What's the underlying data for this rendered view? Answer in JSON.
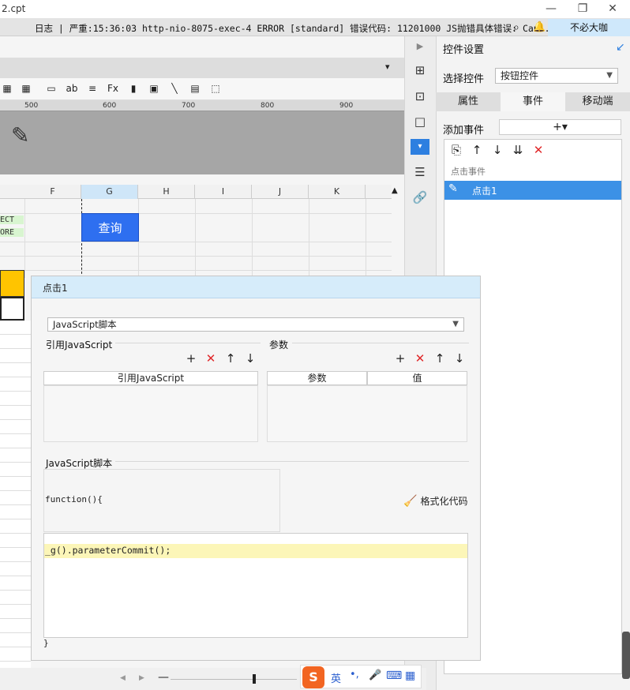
{
  "window": {
    "filename": "2.cpt",
    "minimize": "—",
    "restore": "❐",
    "close": "✕"
  },
  "log": {
    "text": "日志 | 严重:15:36:03 http-nio-8075-exec-4 ERROR [standard] 错误代码: 11201000 JS抛错具体错误: Can...",
    "button": "不必大咖"
  },
  "ruler": {
    "ticks": [
      "500",
      "600",
      "700",
      "800",
      "900"
    ]
  },
  "grid": {
    "columns": [
      "F",
      "G",
      "H",
      "I",
      "J",
      "K"
    ],
    "cell_left_1": "ECT",
    "cell_left_2": "ORE"
  },
  "query_button": {
    "label": "查询"
  },
  "right_panel": {
    "title": "控件设置",
    "select_label": "选择控件",
    "select_value": "按钮控件",
    "tabs": [
      "属性",
      "事件",
      "移动端"
    ],
    "add_event_label": "添加事件",
    "add_event_btn": "+▾",
    "event_group": "点击事件",
    "event_item": "点击1"
  },
  "dialog": {
    "title": "点击1",
    "type_value": "JavaScript脚本",
    "ref_js_section": "引用JavaScript",
    "params_section": "参数",
    "ref_js_col": "引用JavaScript",
    "param_col": "参数",
    "value_col": "值",
    "script_section": "JavaScript脚本",
    "function_head": "function(){",
    "format_button": "格式化代码",
    "code_line": "_g().parameterCommit();",
    "closing": "}"
  },
  "ime": {
    "lang": "英",
    "punct": "•,",
    "mic": "🎤",
    "kbd": "⌨",
    "apps": "▦"
  }
}
